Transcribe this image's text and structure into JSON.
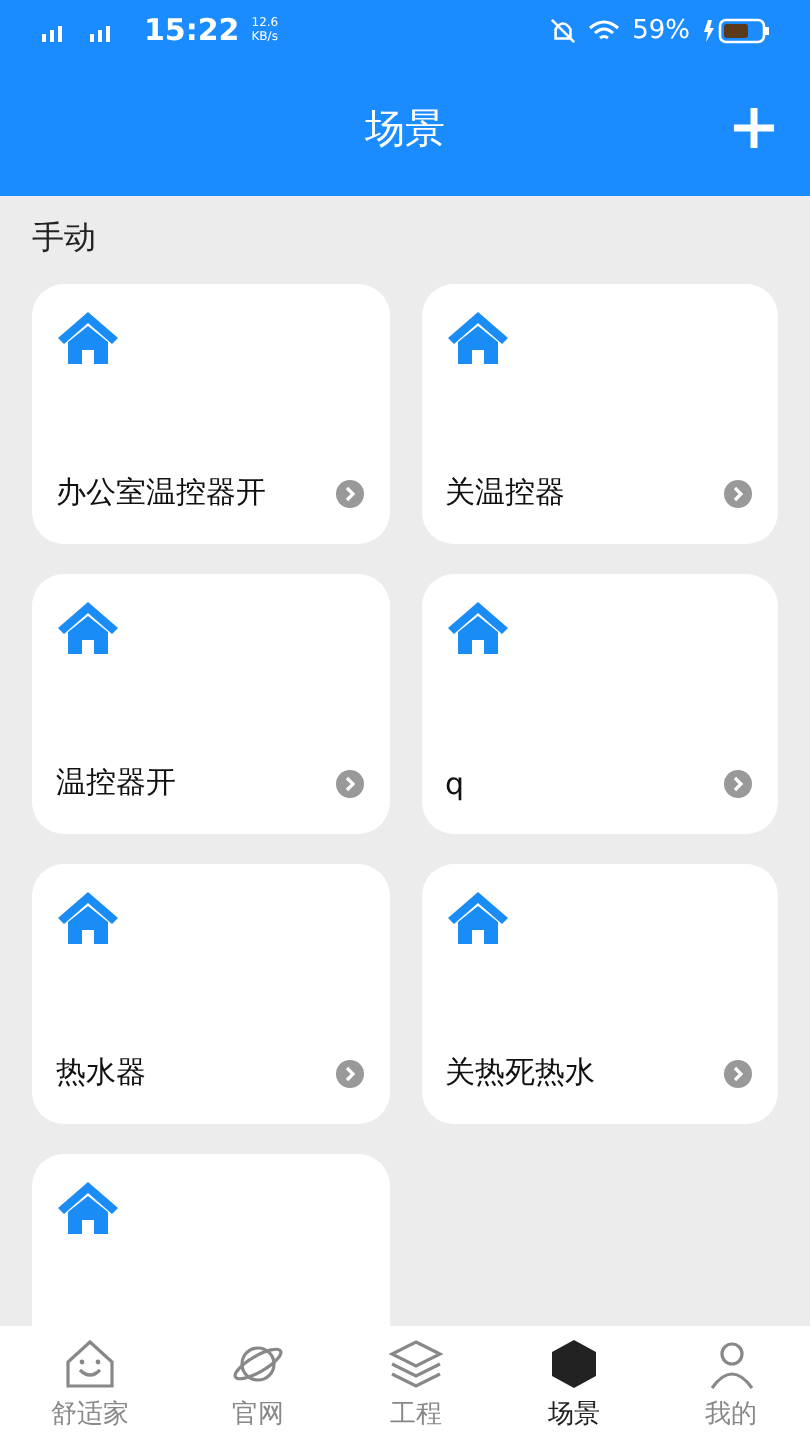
{
  "status_bar": {
    "time": "15:22",
    "speed": "12.6",
    "speed_unit": "KB/s",
    "battery": "59%"
  },
  "header": {
    "title": "场景"
  },
  "section": {
    "title": "手动"
  },
  "scenes": [
    {
      "kind": "named",
      "name": "办公室温控器开"
    },
    {
      "kind": "named",
      "name": "关温控器"
    },
    {
      "kind": "named",
      "name": "温控器开"
    },
    {
      "kind": "named",
      "name": "q"
    },
    {
      "kind": "named",
      "name": "热水器"
    },
    {
      "kind": "named",
      "name": "关热死热水"
    },
    {
      "kind": "cut"
    }
  ],
  "nav": [
    {
      "label": "舒适家",
      "selected": false
    },
    {
      "label": "官网",
      "selected": false
    },
    {
      "label": "工程",
      "selected": false
    },
    {
      "label": "场景",
      "selected": true
    },
    {
      "label": "我的",
      "selected": false
    }
  ]
}
